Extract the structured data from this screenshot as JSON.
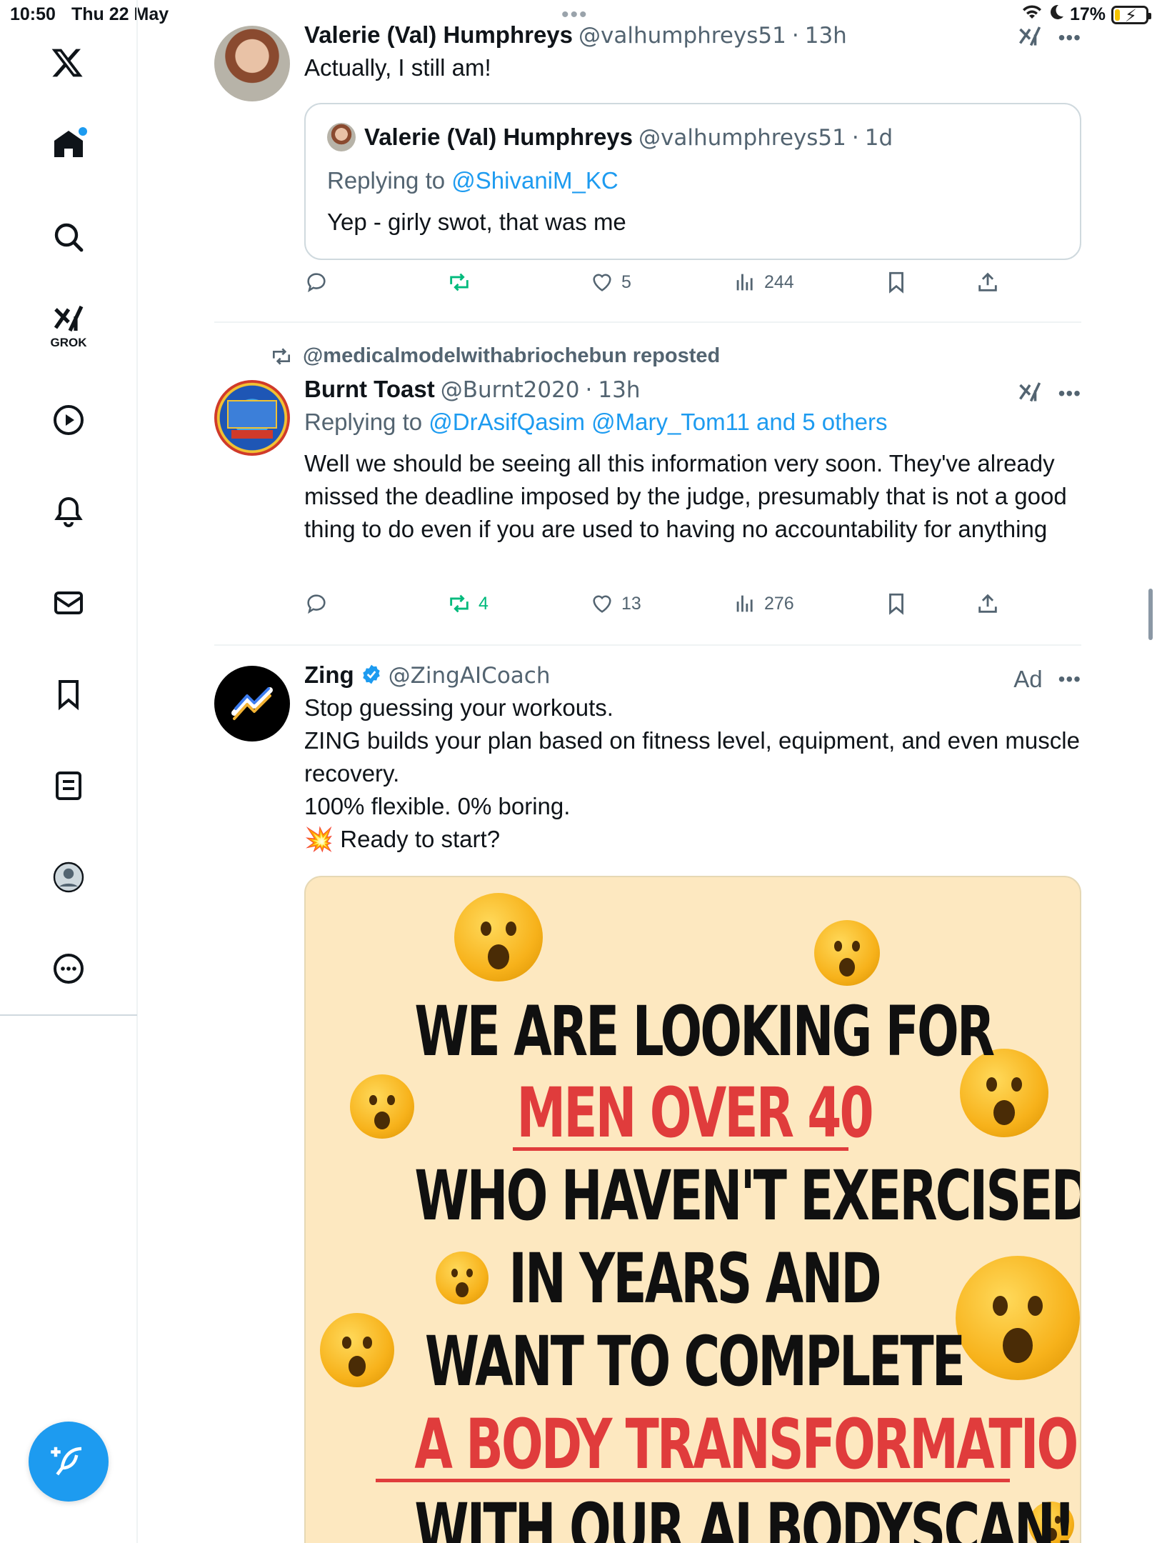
{
  "status_bar": {
    "time": "10:50",
    "date": "Thu 22 May",
    "battery": "17%",
    "battery_level": 0.17
  },
  "sidebar": {
    "items": [
      {
        "name": "x-logo",
        "label": ""
      },
      {
        "name": "home",
        "label": ""
      },
      {
        "name": "search",
        "label": ""
      },
      {
        "name": "grok",
        "label": "GROK"
      },
      {
        "name": "video",
        "label": ""
      },
      {
        "name": "notifications",
        "label": ""
      },
      {
        "name": "messages",
        "label": ""
      },
      {
        "name": "bookmarks",
        "label": ""
      },
      {
        "name": "lists",
        "label": ""
      },
      {
        "name": "profile",
        "label": ""
      },
      {
        "name": "more",
        "label": ""
      }
    ]
  },
  "tweets": [
    {
      "name": "Valerie (Val) Humphreys",
      "handle": "@valhumphreys51",
      "time": "13h",
      "text": "Actually, I still am!",
      "quote": {
        "name": "Valerie (Val) Humphreys",
        "handle": "@valhumphreys51",
        "time": "1d",
        "replying_prefix": "Replying to ",
        "replying_to": "@ShivaniM_KC",
        "text": "Yep - girly swot, that was me"
      },
      "actions": {
        "replies": "",
        "reposts": "",
        "likes": "5",
        "views": "244"
      }
    },
    {
      "reposted_by": "@medicalmodelwithabriochebun reposted",
      "name": "Burnt Toast",
      "handle": "@Burnt2020",
      "time": "13h",
      "replying_prefix": "Replying to ",
      "replying_to": "@DrAsifQasim @Mary_Tom11 and 5 others",
      "text": "Well we should be seeing all this information very soon. They've already missed the deadline imposed by the judge, presumably that is not a good thing to do even if you are used to having no accountability for anything",
      "actions": {
        "replies": "",
        "reposts": "4",
        "likes": "13",
        "views": "276"
      }
    },
    {
      "name": "Zing",
      "handle": "@ZingAICoach",
      "ad_label": "Ad",
      "text_lines": [
        "Stop guessing your workouts.",
        "ZING builds your plan based on fitness level, equipment, and even muscle recovery.",
        "100% flexible. 0% boring."
      ],
      "cta_emoji": "💥",
      "cta_text": "Ready to start?",
      "image_lines": [
        "WE ARE LOOKING FOR",
        "MEN OVER 40",
        "WHO HAVEN'T EXERCISED",
        "IN YEARS AND",
        "WANT TO COMPLETE",
        "A BODY TRANSFORMATION",
        "WITH OUR AI BODYSCAN!"
      ]
    }
  ],
  "separators": {
    "dot": "·"
  },
  "colors": {
    "accent": "#1d9bf0",
    "repost_green": "#00ba7c",
    "muted": "#536471",
    "ad_bg": "#fde8c0",
    "ad_red": "#e03c3c"
  }
}
